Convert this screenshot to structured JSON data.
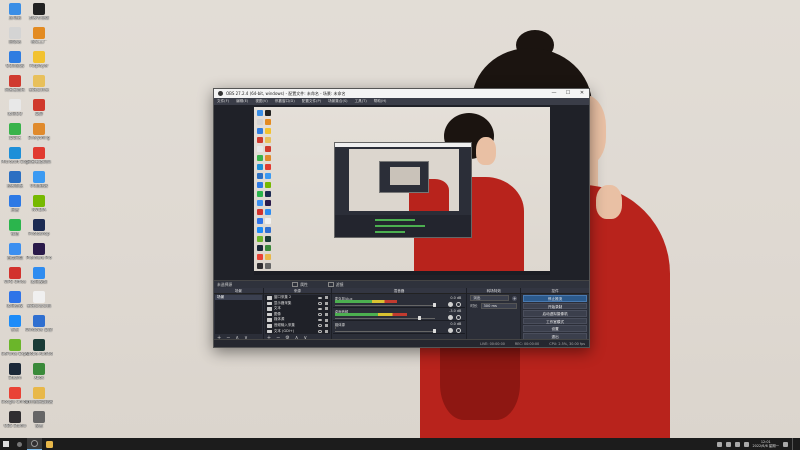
{
  "desktop": {
    "icons": [
      {
        "label": "此电脑",
        "color": "#3a8ee6"
      },
      {
        "label": "回收站",
        "color": "#d4d4d4"
      },
      {
        "label": "QQ浏览器",
        "color": "#2f7de1"
      },
      {
        "label": "网易云音乐",
        "color": "#d03a2f"
      },
      {
        "label": "腾讯QQ",
        "color": "#e8e8e8"
      },
      {
        "label": "爱奇艺",
        "color": "#38b34a"
      },
      {
        "label": "Microsoft Edge",
        "color": "#1e8fd8"
      },
      {
        "label": "控制面板",
        "color": "#2b6fc2"
      },
      {
        "label": "迅雷",
        "color": "#2d79e5"
      },
      {
        "label": "微信",
        "color": "#2bb54d"
      },
      {
        "label": "百度网盘",
        "color": "#3b8ff0"
      },
      {
        "label": "WPS Office",
        "color": "#d2322d"
      },
      {
        "label": "腾讯会议",
        "color": "#2f74e8"
      },
      {
        "label": "钉钉",
        "color": "#1d8cf8"
      },
      {
        "label": "GeForce Experience",
        "color": "#6bb62a"
      },
      {
        "label": "Steam",
        "color": "#1b2838"
      },
      {
        "label": "Google Chrome",
        "color": "#e94235"
      },
      {
        "label": "OBS Studio",
        "color": "#302e31"
      },
      {
        "label": "剪映专业版",
        "color": "#222222"
      },
      {
        "label": "格式工厂",
        "color": "#e38b22"
      },
      {
        "label": "Potplayer",
        "color": "#f2c230"
      },
      {
        "label": "新建文件夹",
        "color": "#e8c05b"
      },
      {
        "label": "录屏",
        "color": "#d0392c"
      },
      {
        "label": "Everything",
        "color": "#e08a2c"
      },
      {
        "label": "网易有道词典",
        "color": "#e13a30"
      },
      {
        "label": "UU加速器",
        "color": "#3b9af2"
      },
      {
        "label": "NVIDIA",
        "color": "#76b900"
      },
      {
        "label": "Photoshop",
        "color": "#1c2b52"
      },
      {
        "label": "Premiere Pro",
        "color": "#2a1a4a"
      },
      {
        "label": "腾讯视频",
        "color": "#2f8cf0"
      },
      {
        "label": "新建文本文档",
        "color": "#f0f0f0"
      },
      {
        "label": "Windows 安全中心",
        "color": "#2f6fd0"
      },
      {
        "label": "Adobe Audition",
        "color": "#1a3b36"
      },
      {
        "label": "Xbox",
        "color": "#3a8a3a"
      },
      {
        "label": "文件资源管理器",
        "color": "#e8b84a"
      },
      {
        "label": "设置",
        "color": "#666666"
      }
    ]
  },
  "obs": {
    "title": "OBS 27.2.4 (64-bit, windows) - 配置文件: 未命名 - 场景: 未命名",
    "window_buttons": {
      "minimize": "—",
      "maximize": "☐",
      "close": "✕"
    },
    "menu": [
      "文件(F)",
      "编辑(E)",
      "视图(V)",
      "停靠窗口(D)",
      "配置文件(P)",
      "场景集合(S)",
      "工具(T)",
      "帮助(H)"
    ],
    "docks_header": {
      "scene_label": "未选择源",
      "properties": "属性",
      "filters": "滤镜"
    },
    "scenes": {
      "title": "场景",
      "items": [
        "场景"
      ],
      "toolbar": [
        "+",
        "−",
        "∧",
        "∨"
      ]
    },
    "sources": {
      "title": "来源",
      "items": [
        "窗口采集 2",
        "显示器采集",
        "文本",
        "图像",
        "媒体源",
        "音频输入采集",
        "文本 (GDI+)"
      ],
      "toolbar": [
        "+",
        "−",
        "⚙",
        "∧",
        "∨"
      ]
    },
    "mixer": {
      "title": "混音器",
      "channels": [
        {
          "name": "麦克风/Aux",
          "db": "0.0 dB",
          "level": 0.62,
          "fader": 0.98
        },
        {
          "name": "桌面音频",
          "db": "-3.0 dB",
          "level": 0.72,
          "fader": 0.83
        },
        {
          "name": "媒体源",
          "db": "0.0 dB",
          "level": 0.0,
          "fader": 0.98
        }
      ]
    },
    "transitions": {
      "title": "转场特效",
      "selected": "淡出",
      "duration_label": "时长",
      "duration": "300 ms"
    },
    "controls": {
      "title": "控件",
      "buttons": [
        "停止推流",
        "开始录制",
        "启动虚拟摄像机",
        "工作室模式",
        "设置",
        "退出"
      ]
    },
    "status": {
      "live": "LIVE: 00:00:00",
      "rec": "REC: 00:00:00",
      "cpu": "CPU: 2.5%, 30.00 fps"
    }
  },
  "taskbar": {
    "clock_time": "12:01",
    "clock_date": "2022/6/6 星期一"
  }
}
